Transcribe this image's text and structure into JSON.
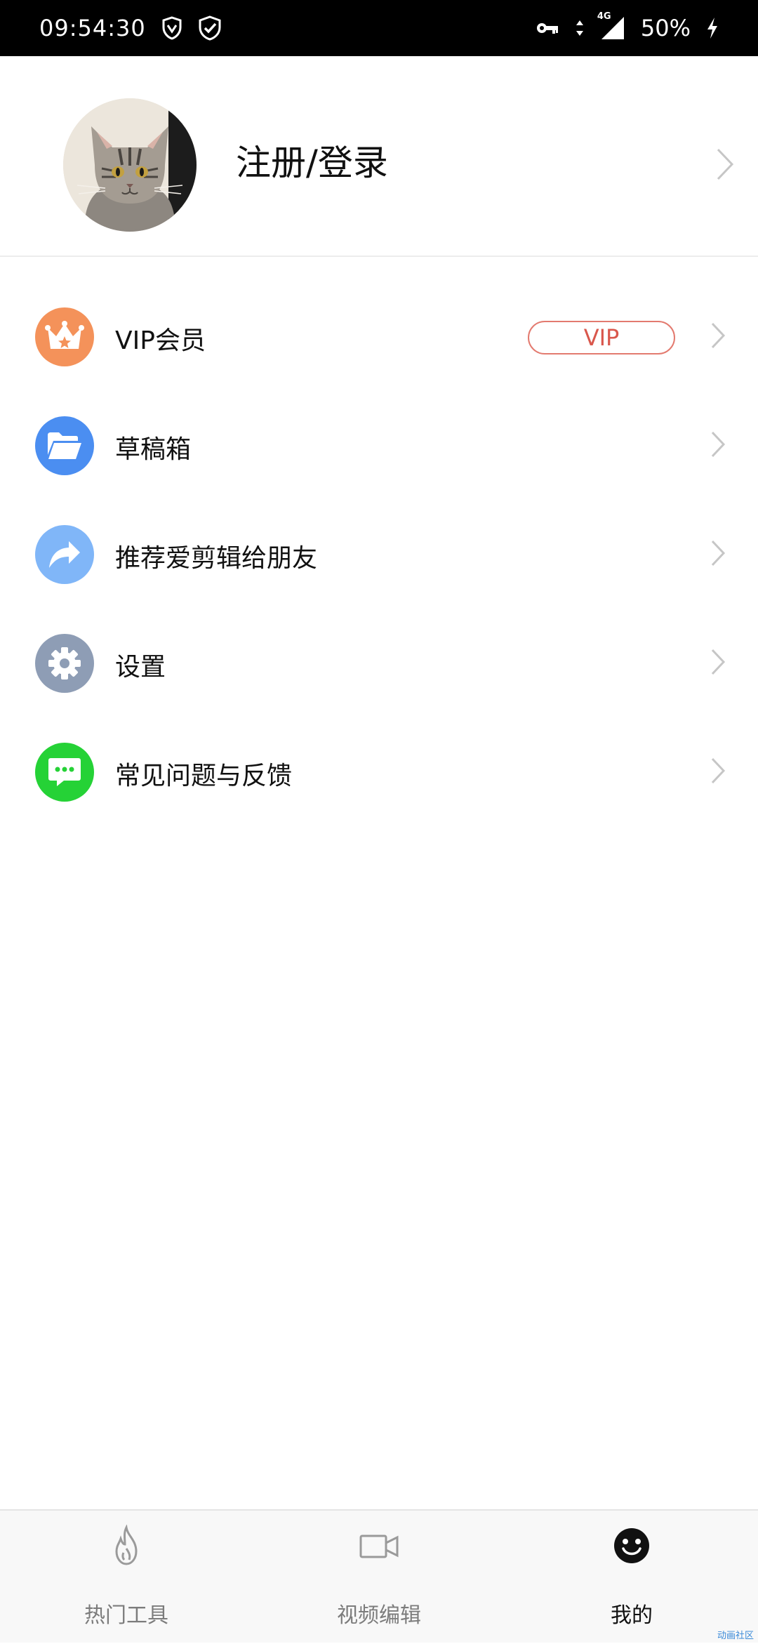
{
  "status_bar": {
    "time": "09:54:30",
    "network": "4G",
    "battery": "50%",
    "icons": [
      "shield-icon",
      "shield-check-icon",
      "vpn-key-icon",
      "data-arrows-icon",
      "signal-icon",
      "charging-icon"
    ]
  },
  "profile": {
    "login_label": "注册/登录",
    "avatar": "cat-avatar"
  },
  "menu": {
    "items": [
      {
        "label": "VIP会员",
        "icon": "crown-icon",
        "color": "#f4925a",
        "badge": "VIP"
      },
      {
        "label": "草稿箱",
        "icon": "folder-icon",
        "color": "#4b8ef1"
      },
      {
        "label": "推荐爱剪辑给朋友",
        "icon": "share-arrow-icon",
        "color": "#80b6f8"
      },
      {
        "label": "设置",
        "icon": "gear-icon",
        "color": "#8e9db5"
      },
      {
        "label": "常见问题与反馈",
        "icon": "chat-bubble-icon",
        "color": "#25d236"
      }
    ]
  },
  "tabs": [
    {
      "label": "热门工具",
      "icon": "flame-icon",
      "active": false
    },
    {
      "label": "视频编辑",
      "icon": "video-camera-icon",
      "active": false
    },
    {
      "label": "我的",
      "icon": "smiley-icon",
      "active": true
    }
  ],
  "watermark": "动画社区",
  "colors": {
    "accent_vip": "#d9574c",
    "chevron": "#c6c6c6",
    "tab_active": "#111111",
    "tab_inactive": "#7c7c7c"
  }
}
